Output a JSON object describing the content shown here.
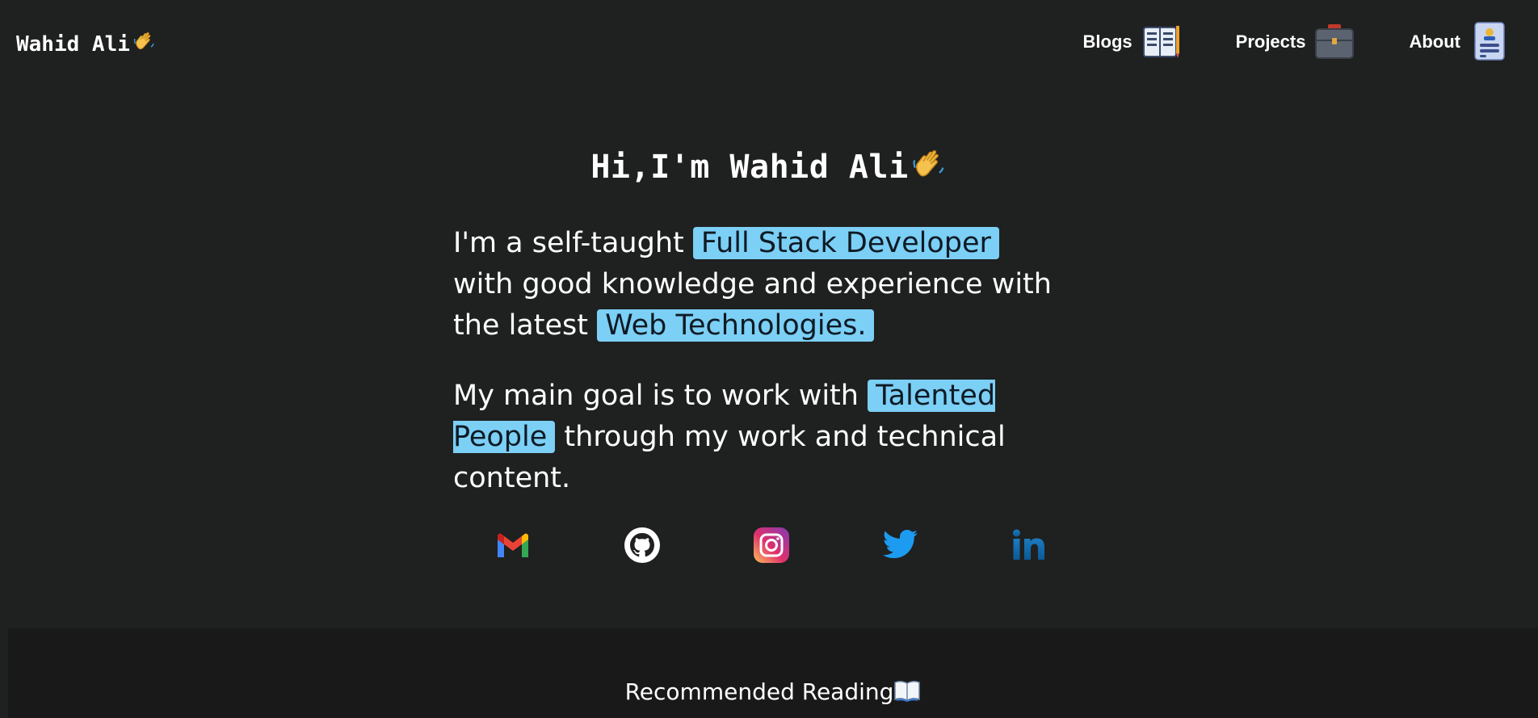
{
  "header": {
    "brand": "Wahid Ali",
    "brand_icon": "waving-hand-icon",
    "nav": [
      {
        "label": "Blogs",
        "icon": "books-icon"
      },
      {
        "label": "Projects",
        "icon": "briefcase-icon"
      },
      {
        "label": "About",
        "icon": "id-card-icon"
      }
    ]
  },
  "hero": {
    "title": "Hi,I'm Wahid Ali",
    "p1_a": "I'm a self-taught ",
    "p1_hl1": "Full Stack Developer",
    "p1_b": " with good knowledge and experience with the latest ",
    "p1_hl2": "Web Technologies.",
    "p2_a": "My main goal is to work with ",
    "p2_hl": "Talented People",
    "p2_b": " through my work and technical content."
  },
  "socials": [
    "gmail-icon",
    "github-icon",
    "instagram-icon",
    "twitter-icon",
    "linkedin-icon"
  ],
  "footer": {
    "recommended": "Recommended Reading",
    "recommended_icon": "open-book-icon"
  },
  "colors": {
    "background": "#1f2020",
    "footer_background": "#191919",
    "highlight": "#7ccff5"
  }
}
